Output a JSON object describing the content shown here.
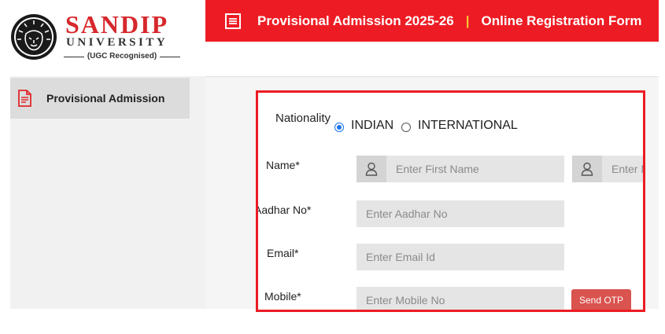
{
  "brand": {
    "name": "SANDIP",
    "subtitle": "UNIVERSITY",
    "recognition": "(UGC Recognised)"
  },
  "sidebar": {
    "items": [
      {
        "label": "Provisional Admission",
        "icon": "document-icon",
        "active": true
      }
    ]
  },
  "header": {
    "title": "Provisional Admission 2025-26",
    "separator": "|",
    "subtitle": "Online Registration Form",
    "icon": "document-list-icon",
    "color": "#ed1c24",
    "separator_color": "#f7c233"
  },
  "form": {
    "nationality": {
      "label": "Nationality",
      "options": [
        "INDIAN",
        "INTERNATIONAL"
      ],
      "selected": "INDIAN"
    },
    "name": {
      "label": "Name*",
      "first_placeholder": "Enter First Name",
      "middle_placeholder": "Enter Middle Name"
    },
    "aadhar": {
      "label": "Aadhar No*",
      "placeholder": "Enter Aadhar No"
    },
    "email": {
      "label": "Email*",
      "placeholder": "Enter Email Id"
    },
    "mobile": {
      "label": "Mobile*",
      "placeholder": "Enter Mobile No"
    },
    "send_otp_label": "Send OTP",
    "highlight_color": "#ec1c24",
    "button_color": "#d9534f"
  }
}
